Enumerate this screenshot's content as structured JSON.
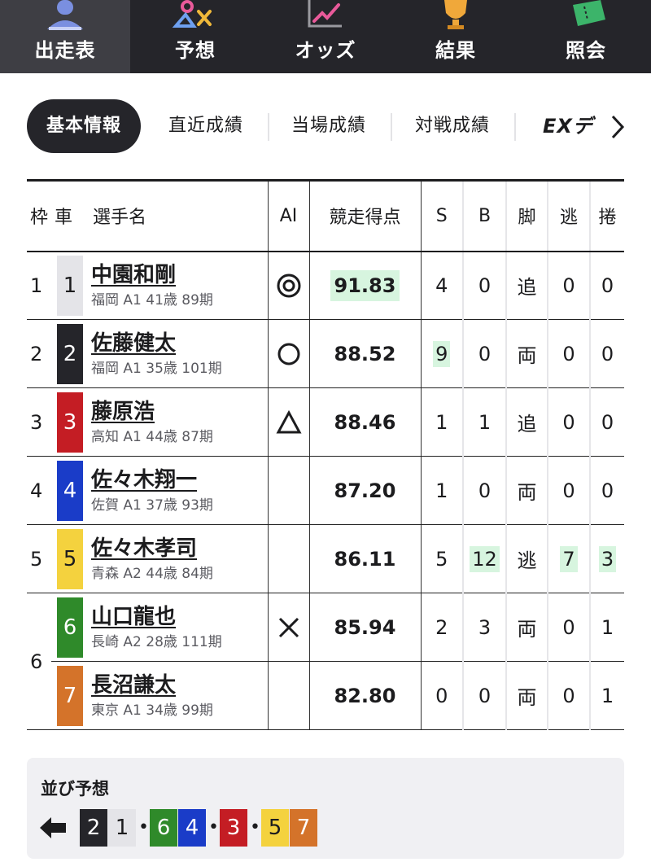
{
  "nav": {
    "items": [
      {
        "label": "出走表",
        "icon": "racer-icon",
        "active": true
      },
      {
        "label": "予想",
        "icon": "prediction-marks-icon",
        "active": false
      },
      {
        "label": "オッズ",
        "icon": "odds-chart-icon",
        "active": false
      },
      {
        "label": "結果",
        "icon": "trophy-icon",
        "active": false
      },
      {
        "label": "照会",
        "icon": "ticket-icon",
        "active": false
      }
    ]
  },
  "tabs": {
    "items": [
      "基本情報",
      "直近成績",
      "当場成績",
      "対戦成績",
      "EXデ"
    ],
    "active_index": 0,
    "more_icon": "chevron-right-icon"
  },
  "table": {
    "headers": {
      "frame": "枠",
      "car": "車",
      "name": "選手名",
      "ai": "AI",
      "score": "競走得点",
      "s": "S",
      "b": "B",
      "style": "脚",
      "nige": "逃",
      "makuri": "捲"
    },
    "rows": [
      {
        "frame": "1",
        "car": "1",
        "name": "中園和剛",
        "info": "福岡 A1 41歳 89期",
        "ai_mark": "double-circle",
        "score": "91.83",
        "s": "4",
        "b": "0",
        "style": "追",
        "nige": "0",
        "makuri": "0"
      },
      {
        "frame": "2",
        "car": "2",
        "name": "佐藤健太",
        "info": "福岡 A1 35歳 101期",
        "ai_mark": "circle",
        "score": "88.52",
        "s": "9",
        "b": "0",
        "style": "両",
        "nige": "0",
        "makuri": "0"
      },
      {
        "frame": "3",
        "car": "3",
        "name": "藤原浩",
        "info": "高知 A1 44歳 87期",
        "ai_mark": "triangle",
        "score": "88.46",
        "s": "1",
        "b": "1",
        "style": "追",
        "nige": "0",
        "makuri": "0"
      },
      {
        "frame": "4",
        "car": "4",
        "name": "佐々木翔一",
        "info": "佐賀 A1 37歳 93期",
        "ai_mark": "",
        "score": "87.20",
        "s": "1",
        "b": "0",
        "style": "両",
        "nige": "0",
        "makuri": "0"
      },
      {
        "frame": "5",
        "car": "5",
        "name": "佐々木孝司",
        "info": "青森 A2 44歳 84期",
        "ai_mark": "",
        "score": "86.11",
        "s": "5",
        "b": "12",
        "style": "逃",
        "nige": "7",
        "makuri": "3"
      },
      {
        "frame": "6",
        "car": "6",
        "name": "山口龍也",
        "info": "長崎 A2 28歳 111期",
        "ai_mark": "cross",
        "score": "85.94",
        "s": "2",
        "b": "3",
        "style": "両",
        "nige": "0",
        "makuri": "1"
      },
      {
        "frame": "",
        "car": "7",
        "name": "長沼謙太",
        "info": "東京 A1 34歳 99期",
        "ai_mark": "",
        "score": "82.80",
        "s": "0",
        "b": "0",
        "style": "両",
        "nige": "0",
        "makuri": "1"
      }
    ]
  },
  "line_forecast": {
    "title": "並び予想",
    "direction_icon": "arrow-left-icon",
    "sequence": [
      "2",
      "1",
      "6",
      "4",
      "3",
      "5",
      "7"
    ]
  },
  "colors": {
    "car_1": "#e4e4e8",
    "car_2": "#25252a",
    "car_3": "#c41d24",
    "car_4": "#1a3cc8",
    "car_5": "#f4d23e",
    "car_6": "#2f8a2a",
    "car_7": "#d4732a",
    "highlight": "#d7f5df",
    "nav_bg": "#25252a"
  }
}
